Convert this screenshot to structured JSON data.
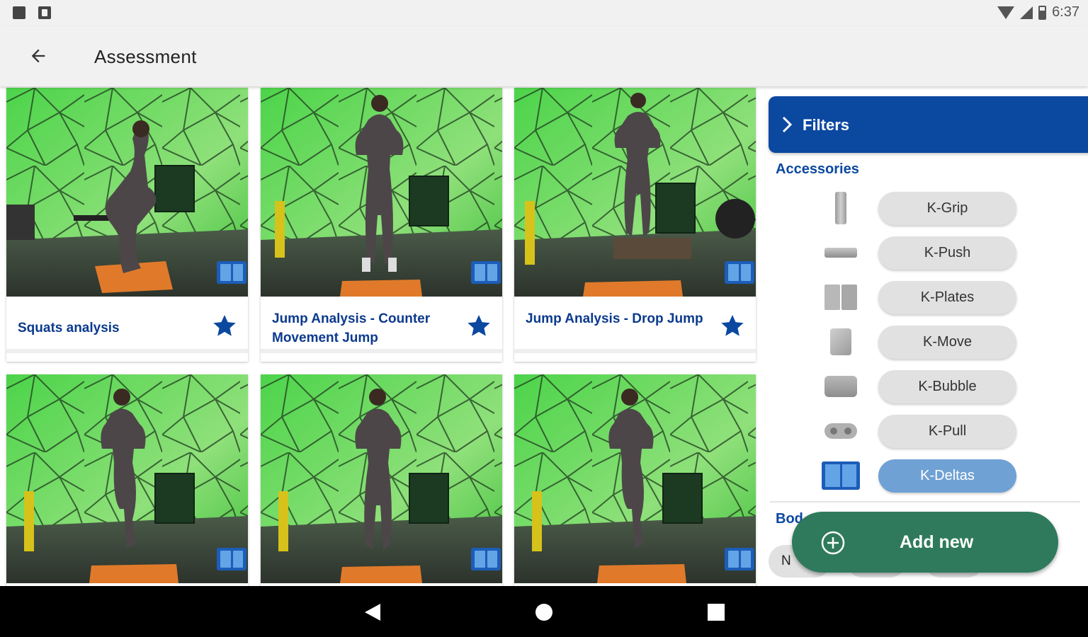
{
  "status_bar": {
    "time": "6:37"
  },
  "app_bar": {
    "title": "Assessment"
  },
  "cards": [
    {
      "title": "Squats analysis",
      "favorite": true,
      "accessory_icon": "k-deltas-icon"
    },
    {
      "title": "Jump Analysis - Counter Movement Jump",
      "favorite": true,
      "accessory_icon": "k-deltas-icon"
    },
    {
      "title": "Jump Analysis - Drop Jump",
      "favorite": true,
      "accessory_icon": "k-deltas-icon"
    },
    {
      "title": "",
      "favorite": false,
      "accessory_icon": "k-deltas-icon"
    },
    {
      "title": "",
      "favorite": false,
      "accessory_icon": "k-deltas-icon"
    },
    {
      "title": "",
      "favorite": false,
      "accessory_icon": "k-deltas-icon"
    }
  ],
  "filters": {
    "label": "Filters",
    "accessories_title": "Accessories",
    "accessories": [
      {
        "label": "K-Grip",
        "icon": "k-grip-icon",
        "selected": false
      },
      {
        "label": "K-Push",
        "icon": "k-push-icon",
        "selected": false
      },
      {
        "label": "K-Plates",
        "icon": "k-plates-icon",
        "selected": false
      },
      {
        "label": "K-Move",
        "icon": "k-move-icon",
        "selected": false
      },
      {
        "label": "K-Bubble",
        "icon": "k-bubble-icon",
        "selected": false
      },
      {
        "label": "K-Pull",
        "icon": "k-pull-icon",
        "selected": false
      },
      {
        "label": "K-Deltas",
        "icon": "k-deltas-icon",
        "selected": true
      }
    ],
    "body_title_partial": "Bod",
    "body_chip_partial": "N"
  },
  "fab": {
    "label": "Add new"
  },
  "colors": {
    "brand_blue": "#0b48a0",
    "title_blue": "#0b3a8e",
    "selected_chip": "#6fa1d4",
    "fab_green": "#2f7a5c",
    "photo_green": "#3fbf3a"
  }
}
